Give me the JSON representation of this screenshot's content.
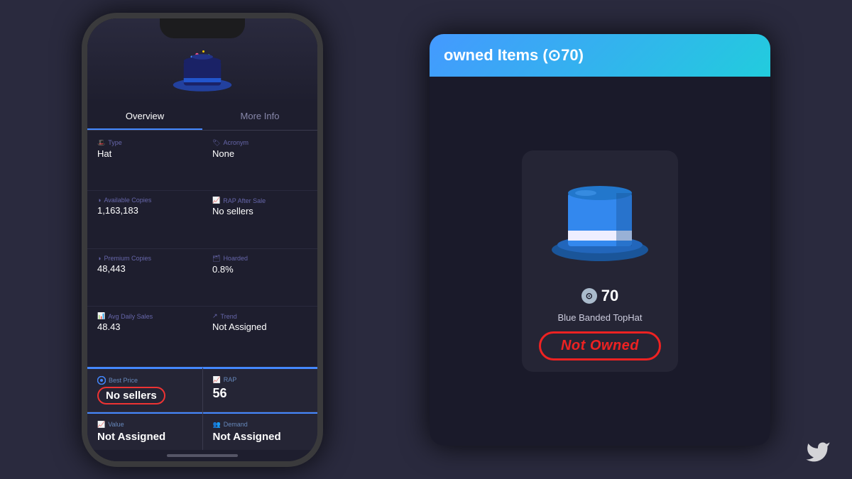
{
  "phone": {
    "hat_alt": "Party Hat",
    "tabs": [
      "Overview",
      "More Info"
    ],
    "active_tab": 0,
    "info_rows": [
      {
        "left": {
          "label": "Type",
          "value": "Hat",
          "icon": "🎩"
        },
        "right": {
          "label": "Acronym",
          "value": "None",
          "icon": "🏷"
        }
      },
      {
        "left": {
          "label": "Available Copies",
          "value": "1,163,183",
          "icon": "◑"
        },
        "right": {
          "label": "RAP After Sale",
          "value": "No sellers",
          "icon": "📈"
        }
      },
      {
        "left": {
          "label": "Premium Copies",
          "value": "48,443",
          "icon": "◑"
        },
        "right": {
          "label": "Hoarded",
          "value": "0.8%",
          "icon": "🗂"
        }
      },
      {
        "left": {
          "label": "Avg Daily Sales",
          "value": "48.43",
          "icon": "📊"
        },
        "right": {
          "label": "Trend",
          "value": "Not Assigned",
          "icon": "↗"
        }
      }
    ],
    "cards": [
      {
        "label": "Best Price",
        "value": "No sellers",
        "icon": "🔵",
        "highlight": true
      },
      {
        "label": "RAP",
        "value": "56",
        "icon": "📈",
        "highlight": false
      },
      {
        "label": "Value",
        "value": "Not Assigned",
        "icon": "📈",
        "highlight": false
      },
      {
        "label": "Demand",
        "value": "Not Assigned",
        "icon": "👥",
        "highlight": false
      }
    ]
  },
  "right_panel": {
    "header": "owned Items (⊙70)",
    "item": {
      "price": "70",
      "name": "Blue Banded TopHat",
      "status": "Not Owned"
    }
  },
  "colors": {
    "accent": "#4488ff",
    "highlight_red": "#ee2222",
    "bg_dark": "#1e1e2e",
    "card_bg": "#252535"
  }
}
